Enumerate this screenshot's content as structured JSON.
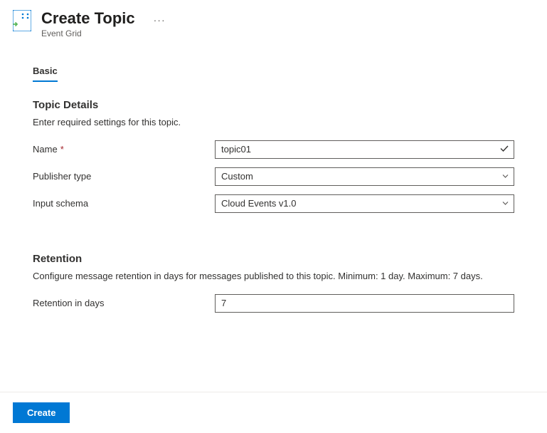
{
  "header": {
    "title": "Create Topic",
    "subtitle": "Event Grid"
  },
  "tabs": {
    "basic": "Basic"
  },
  "topic_details": {
    "heading": "Topic Details",
    "description": "Enter required settings for this topic.",
    "name_label": "Name",
    "name_value": "topic01",
    "publisher_type_label": "Publisher type",
    "publisher_type_value": "Custom",
    "input_schema_label": "Input schema",
    "input_schema_value": "Cloud Events v1.0"
  },
  "retention": {
    "heading": "Retention",
    "description": "Configure message retention in days for messages published to this topic. Minimum: 1 day. Maximum: 7 days.",
    "retention_days_label": "Retention in days",
    "retention_days_value": "7"
  },
  "footer": {
    "create_label": "Create"
  }
}
